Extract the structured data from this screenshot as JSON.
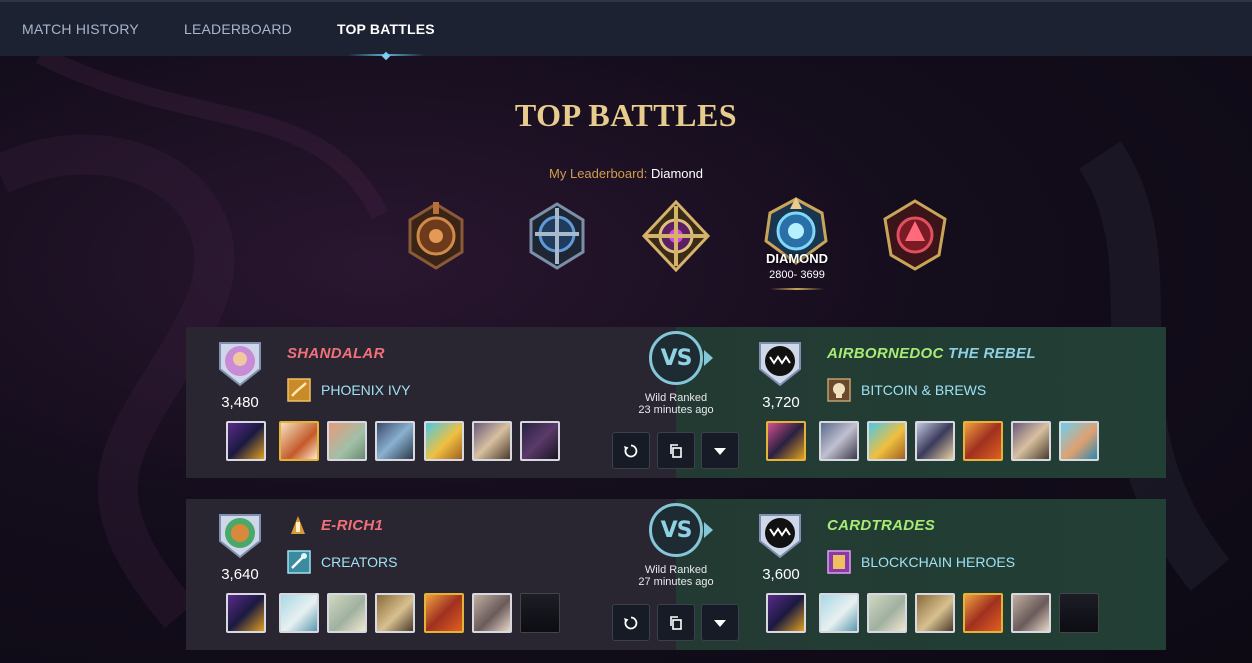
{
  "nav": {
    "tabs": [
      {
        "label": "MATCH HISTORY",
        "active": false
      },
      {
        "label": "LEADERBOARD",
        "active": false
      },
      {
        "label": "TOP BATTLES",
        "active": true
      }
    ]
  },
  "page_title": "TOP BATTLES",
  "leaderboard": {
    "label": "My Leaderboard:",
    "value": "Diamond",
    "leagues": [
      {
        "icon": "bronze-league-icon",
        "color": "#b8703a"
      },
      {
        "icon": "silver-league-icon",
        "color": "#4a7fb8"
      },
      {
        "icon": "gold-league-icon",
        "color": "#c24ac9"
      },
      {
        "icon": "diamond-league-icon",
        "color": "#3ab4e8",
        "selected": true,
        "name": "DIAMOND",
        "range": "2800- 3699"
      },
      {
        "icon": "champion-league-icon",
        "color": "#c23a3a"
      }
    ]
  },
  "battles": [
    {
      "player1": {
        "name": "SHANDALAR",
        "rating": "3,480",
        "guild": "PHOENIX IVY",
        "guild_icon": "phoenix-ivy-guild-icon",
        "avatar": "wizard-avatar-icon"
      },
      "player2": {
        "name": "AIRBORNEDOC",
        "suffix": "THE REBEL",
        "rating": "3,720",
        "guild": "BITCOIN & BREWS",
        "guild_icon": "bitcoin-brews-guild-icon",
        "avatar": "monster-mouth-avatar-icon"
      },
      "vs": "VS",
      "mode": "Wild Ranked",
      "time": "23 minutes ago"
    },
    {
      "player1": {
        "name": "E-RICH1",
        "rating": "3,640",
        "guild": "CREATORS",
        "guild_icon": "creators-guild-icon",
        "avatar": "lion-avatar-icon",
        "rank_icon": "rank-icon"
      },
      "player2": {
        "name": "CARDTRADES",
        "rating": "3,600",
        "guild": "BLOCKCHAIN HEROES",
        "guild_icon": "blockchain-heroes-guild-icon",
        "avatar": "monster-mouth-avatar-icon"
      },
      "vs": "VS",
      "mode": "Wild Ranked",
      "time": "27 minutes ago"
    }
  ],
  "colors": {
    "accent_gold": "#e8cc8e",
    "player_red": "#f2707a",
    "player_green": "#a6ec74",
    "guild_text": "#9fe2f5"
  }
}
